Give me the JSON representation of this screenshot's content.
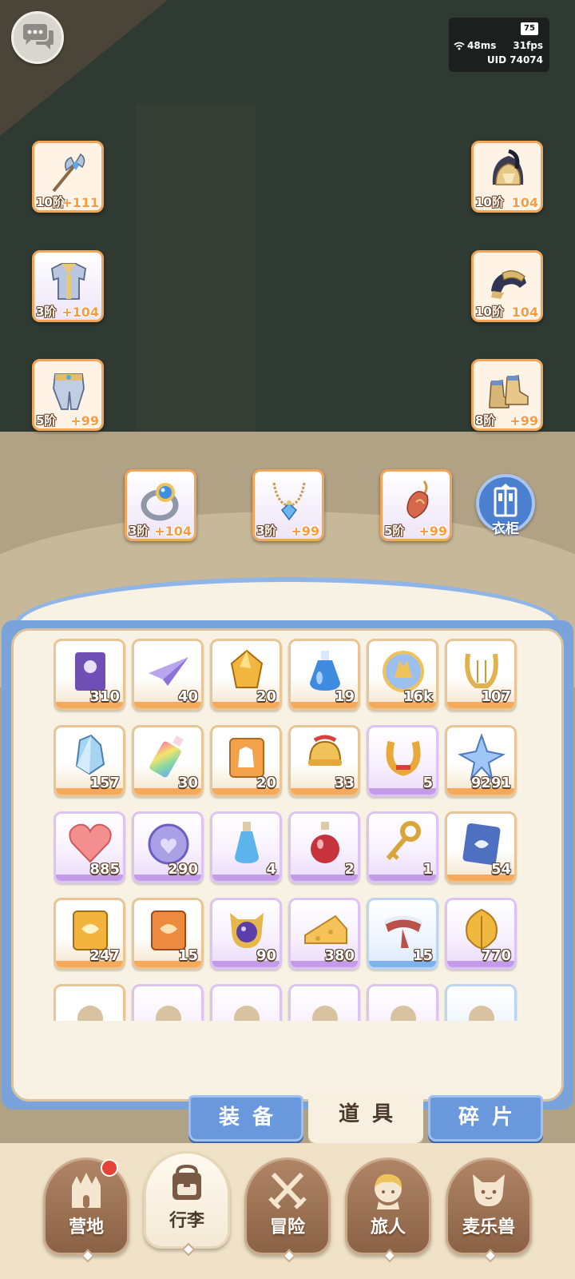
{
  "status": {
    "battery": "75",
    "ping": "48ms",
    "fps": "31fps",
    "uid": "UID 74074"
  },
  "equipment": [
    {
      "icon": "halberd-icon",
      "tier": "10阶",
      "level": "+111"
    },
    {
      "icon": "helmet-icon",
      "tier": "10阶",
      "level": "104"
    },
    {
      "icon": "armor-icon",
      "tier": "3阶",
      "level": "+104"
    },
    {
      "icon": "gauntlet-icon",
      "tier": "10阶",
      "level": "104"
    },
    {
      "icon": "leggings-icon",
      "tier": "5阶",
      "level": "+99"
    },
    {
      "icon": "boots-icon",
      "tier": "8阶",
      "level": "+99"
    },
    {
      "icon": "ring-icon",
      "tier": "3阶",
      "level": "+104"
    },
    {
      "icon": "necklace-icon",
      "tier": "3阶",
      "level": "+99"
    },
    {
      "icon": "charm-icon",
      "tier": "5阶",
      "level": "+99"
    }
  ],
  "wardrobe_label": "衣柜",
  "items": [
    {
      "icon": "ticket-icon",
      "count": "310",
      "rarity": "orange"
    },
    {
      "icon": "paper-plane-icon",
      "count": "40",
      "rarity": "orange"
    },
    {
      "icon": "gold-crystal-icon",
      "count": "20",
      "rarity": "orange"
    },
    {
      "icon": "blue-potion-icon",
      "count": "19",
      "rarity": "orange"
    },
    {
      "icon": "gold-orb-icon",
      "count": "16k",
      "rarity": "orange"
    },
    {
      "icon": "lyre-icon",
      "count": "107",
      "rarity": "orange"
    },
    {
      "icon": "ice-crystal-icon",
      "count": "157",
      "rarity": "orange"
    },
    {
      "icon": "paint-tube-icon",
      "count": "30",
      "rarity": "orange"
    },
    {
      "icon": "outfit-card-icon",
      "count": "20",
      "rarity": "orange"
    },
    {
      "icon": "bell-icon",
      "count": "33",
      "rarity": "orange"
    },
    {
      "icon": "horseshoe-icon",
      "count": "5",
      "rarity": "purple"
    },
    {
      "icon": "star-crystal-icon",
      "count": "9291",
      "rarity": "orange"
    },
    {
      "icon": "heart-icon",
      "count": "885",
      "rarity": "purple"
    },
    {
      "icon": "heart-coin-icon",
      "count": "290",
      "rarity": "purple"
    },
    {
      "icon": "blue-flask-icon",
      "count": "4",
      "rarity": "purple"
    },
    {
      "icon": "red-flask-icon",
      "count": "2",
      "rarity": "purple"
    },
    {
      "icon": "key-icon",
      "count": "1",
      "rarity": "purple"
    },
    {
      "icon": "blue-card-icon",
      "count": "54",
      "rarity": "orange"
    },
    {
      "icon": "gold-card-icon",
      "count": "247",
      "rarity": "orange"
    },
    {
      "icon": "red-card-icon",
      "count": "15",
      "rarity": "orange"
    },
    {
      "icon": "cat-mirror-icon",
      "count": "90",
      "rarity": "purple"
    },
    {
      "icon": "cheese-icon",
      "count": "380",
      "rarity": "purple"
    },
    {
      "icon": "scarf-icon",
      "count": "15",
      "rarity": "blue"
    },
    {
      "icon": "leaf-icon",
      "count": "770",
      "rarity": "purple"
    },
    {
      "icon": "item-icon",
      "count": "",
      "rarity": "orange"
    },
    {
      "icon": "item-icon",
      "count": "",
      "rarity": "purple"
    },
    {
      "icon": "item-icon",
      "count": "",
      "rarity": "purple"
    },
    {
      "icon": "item-icon",
      "count": "",
      "rarity": "purple"
    },
    {
      "icon": "item-icon",
      "count": "",
      "rarity": "purple"
    },
    {
      "icon": "item-icon",
      "count": "",
      "rarity": "blue"
    }
  ],
  "tabs": [
    {
      "label": "装备"
    },
    {
      "label": "道具"
    },
    {
      "label": "碎片"
    }
  ],
  "active_tab": "道具",
  "nav": [
    {
      "label": "营地",
      "icon": "castle-icon"
    },
    {
      "label": "行李",
      "icon": "backpack-icon"
    },
    {
      "label": "冒险",
      "icon": "crossed-swords-icon"
    },
    {
      "label": "旅人",
      "icon": "character-icon"
    },
    {
      "label": "麦乐兽",
      "icon": "pet-icon"
    }
  ],
  "colors": {
    "orange": "#f5a95b",
    "purple": "#c49be8",
    "blue": "#7eb2ec",
    "panel": "#7aa2db"
  }
}
